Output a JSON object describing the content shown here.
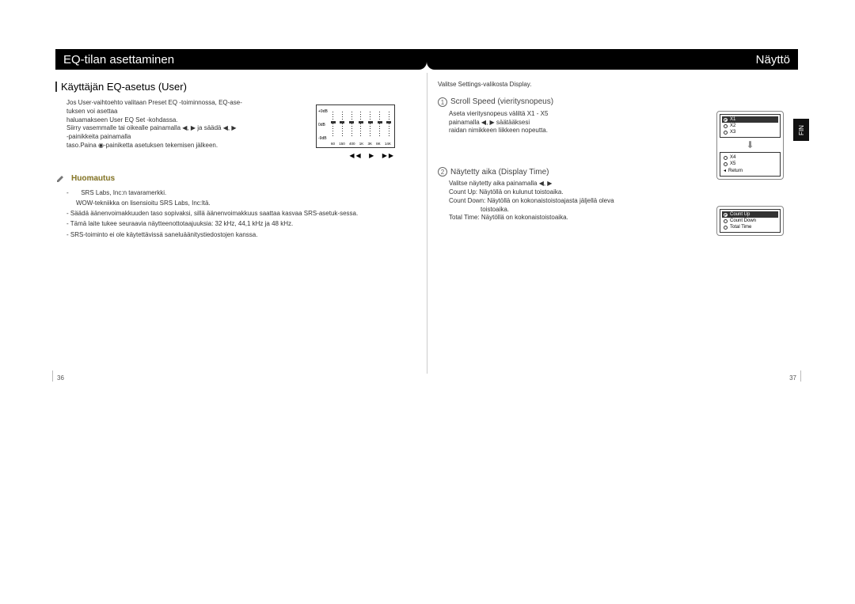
{
  "left": {
    "header": "EQ-tilan asettaminen",
    "section_title": "Käyttäjän EQ-asetus (User)",
    "bullet1": "Jos User-vaihtoehto valitaan Preset EQ -toiminnossa, EQ-ase-tuksen voi asettaa",
    "bullet1b": "haluamakseen User EQ Set -kohdassa.",
    "bullet2": "Siirry vasemmalle tai oikealle painamalla ◀, ▶ ja säädä ◀, ▶",
    "bullet2b": "-painikkeita painamalla",
    "bullet2c": "taso.Paina ◉-painiketta asetuksen tekemisen jälkeen.",
    "note_heading": "Huomautus",
    "notes": [
      "-       SRS Labs, Inc:n tavaramerkki.",
      "  WOW-tekniikka on lisensioitu SRS Labs, Inc:ltä.",
      "- Säädä äänenvoimakkuuden taso sopivaksi, sillä äänenvoimakkuus saattaa kasvaa SRS-asetuk-sessa.",
      "- Tämä laite tukee seuraavia näytteenottotaajuuksia: 32 kHz, 44,1 kHz ja 48 kHz.",
      "- SRS-toiminto ei ole käytettävissä saneluäänitystiedostojen kanssa."
    ],
    "eq_db": [
      "+9dB",
      "0dB",
      "-9dB"
    ],
    "eq_freq": [
      "60",
      "150",
      "400",
      "1K",
      "3K",
      "8K",
      "14K"
    ],
    "page_num": "36"
  },
  "right": {
    "header": "Näyttö",
    "intro": "Valitse Settings-valikosta Display.",
    "sec1_circ": "1",
    "sec1_title": "Scroll Speed (vieritysnopeus)",
    "sec1_b1": "Aseta vieritysnopeus väliltä X1 - X5",
    "sec1_b2": "painamalla ◀, ▶ säätääksesi",
    "sec1_b3": "raidan nimikkeen liikkeen nopeutta.",
    "sec2_circ": "2",
    "sec2_title": "Näytetty aika (Display Time)",
    "sec2_b1": "Valitse näytetty aika painamalla  ◀, ▶",
    "sec2_b2": "Count Up: Näytöllä on kulunut toistoaika.",
    "sec2_b3": "Count Down: Näytöllä on kokonaistoistoajasta jäljellä oleva",
    "sec2_b3b": "toistoaika.",
    "sec2_b4": "Total Time: Näytöllä on kokonaistoistoaika.",
    "screen1_top": [
      "X1",
      "X2",
      "X3"
    ],
    "screen1_bot": [
      "X4",
      "X5",
      "Return"
    ],
    "screen2": [
      "Count Up",
      "Count Down",
      "Total Time"
    ],
    "side_tab": "FIN",
    "page_num": "37"
  }
}
